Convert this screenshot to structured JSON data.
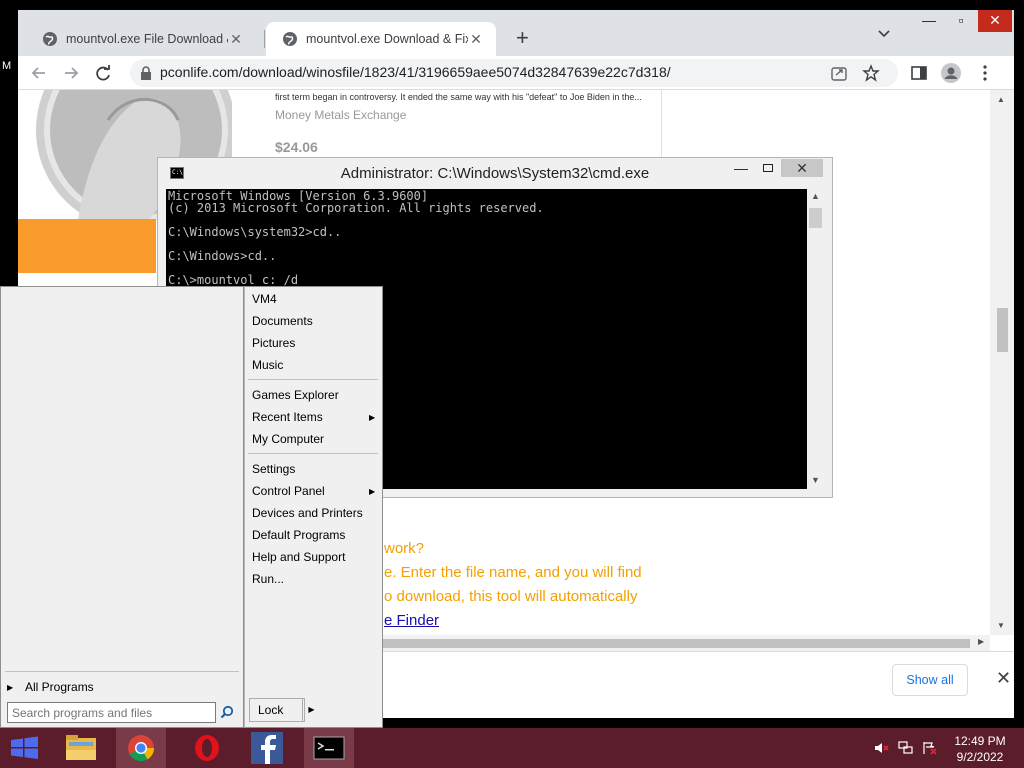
{
  "browser": {
    "tabs": [
      {
        "title": "mountvol.exe File Download & Fi",
        "active": false
      },
      {
        "title": "mountvol.exe Download & Fix Fo",
        "active": true
      }
    ],
    "url": "pconlife.com/download/winosfile/1823/41/3196659aee5074d32847639e22c7d318/",
    "stray_letter": "M"
  },
  "page": {
    "ad": {
      "snippet": "first term began in controversy. It ended the same way with his \"defeat\" to Joe Biden in the...",
      "source": "Money Metals Exchange",
      "price": "$24.06"
    },
    "article": {
      "line1": "work?",
      "line2": "e. Enter the file name, and you will find",
      "line3": "o download, this tool will automatically",
      "link": "e Finder"
    },
    "download_bar": {
      "show_all": "Show all"
    }
  },
  "cmd": {
    "title": "Administrator: C:\\Windows\\System32\\cmd.exe",
    "icon_text": "C:\\",
    "lines": [
      "Microsoft Windows [Version 6.3.9600]",
      "(c) 2013 Microsoft Corporation. All rights reserved.",
      "",
      "C:\\Windows\\system32>cd..",
      "",
      "C:\\Windows>cd..",
      "",
      "C:\\>mountvol c: /d"
    ]
  },
  "start_menu": {
    "right_items": [
      "VM4",
      "Documents",
      "Pictures",
      "Music",
      "Games Explorer",
      "Recent Items",
      "My Computer",
      "Settings",
      "Control Panel",
      "Devices and Printers",
      "Default Programs",
      "Help and Support",
      "Run..."
    ],
    "all_programs": "All Programs",
    "search_placeholder": "Search programs and files",
    "lock": "Lock"
  },
  "taskbar": {
    "apps": [
      "start",
      "file-explorer",
      "chrome",
      "opera",
      "facebook",
      "cmd"
    ],
    "time": "12:49 PM",
    "date": "9/2/2022",
    "accent": "#5b1c2b"
  }
}
